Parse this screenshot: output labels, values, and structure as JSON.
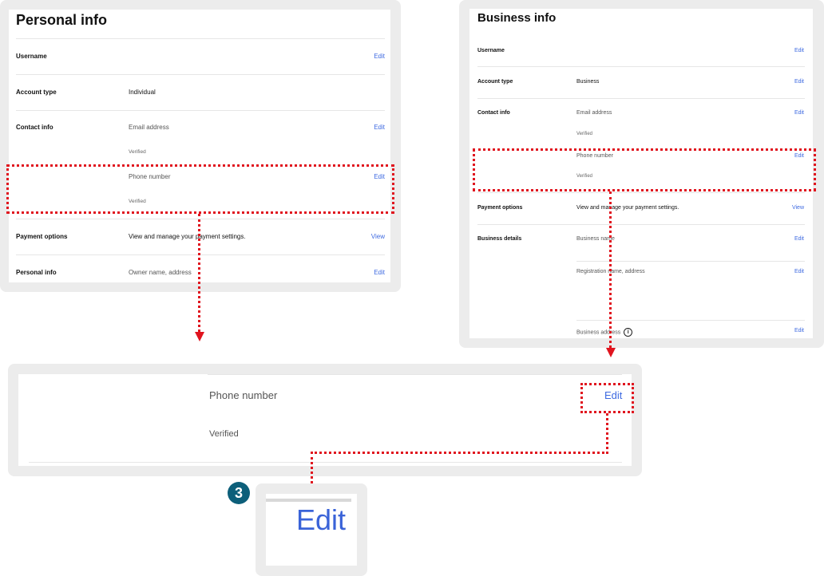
{
  "personal_panel": {
    "title": "Personal info",
    "rows": {
      "username": {
        "label": "Username",
        "action": "Edit"
      },
      "account_type": {
        "label": "Account type",
        "value": "Individual"
      },
      "contact_info": {
        "label": "Contact info",
        "email": "Email address",
        "email_status": "Verified",
        "email_action": "Edit",
        "phone": "Phone number",
        "phone_status": "Verified",
        "phone_action": "Edit"
      },
      "payment_options": {
        "label": "Payment options",
        "value": "View and manage your payment settings.",
        "action": "View"
      },
      "personal_info": {
        "label": "Personal info",
        "value": "Owner name, address",
        "action": "Edit"
      }
    }
  },
  "business_panel": {
    "title": "Business info",
    "rows": {
      "username": {
        "label": "Username",
        "action": "Edit"
      },
      "account_type": {
        "label": "Account type",
        "value": "Business",
        "action": "Edit"
      },
      "contact_info": {
        "label": "Contact info",
        "email": "Email address",
        "email_status": "Verified",
        "email_action": "Edit",
        "phone": "Phone number",
        "phone_status": "Verified",
        "phone_action": "Edit"
      },
      "payment_options": {
        "label": "Payment options",
        "value": "View and manage your payment settings.",
        "action": "View"
      },
      "business_details": {
        "label": "Business details",
        "business_name": "Business name",
        "business_name_action": "Edit",
        "registration": "Registration name, address",
        "registration_action": "Edit",
        "business_address": "Business address",
        "business_address_action": "Edit"
      }
    }
  },
  "zoom_panel": {
    "phone": "Phone number",
    "status": "Verified",
    "action": "Edit"
  },
  "zoom_edit": {
    "step": "3",
    "action": "Edit"
  },
  "colors": {
    "link": "#3e6ae1",
    "highlight": "#e0141e",
    "badge": "#0d5f7a",
    "frame": "#ececec"
  }
}
